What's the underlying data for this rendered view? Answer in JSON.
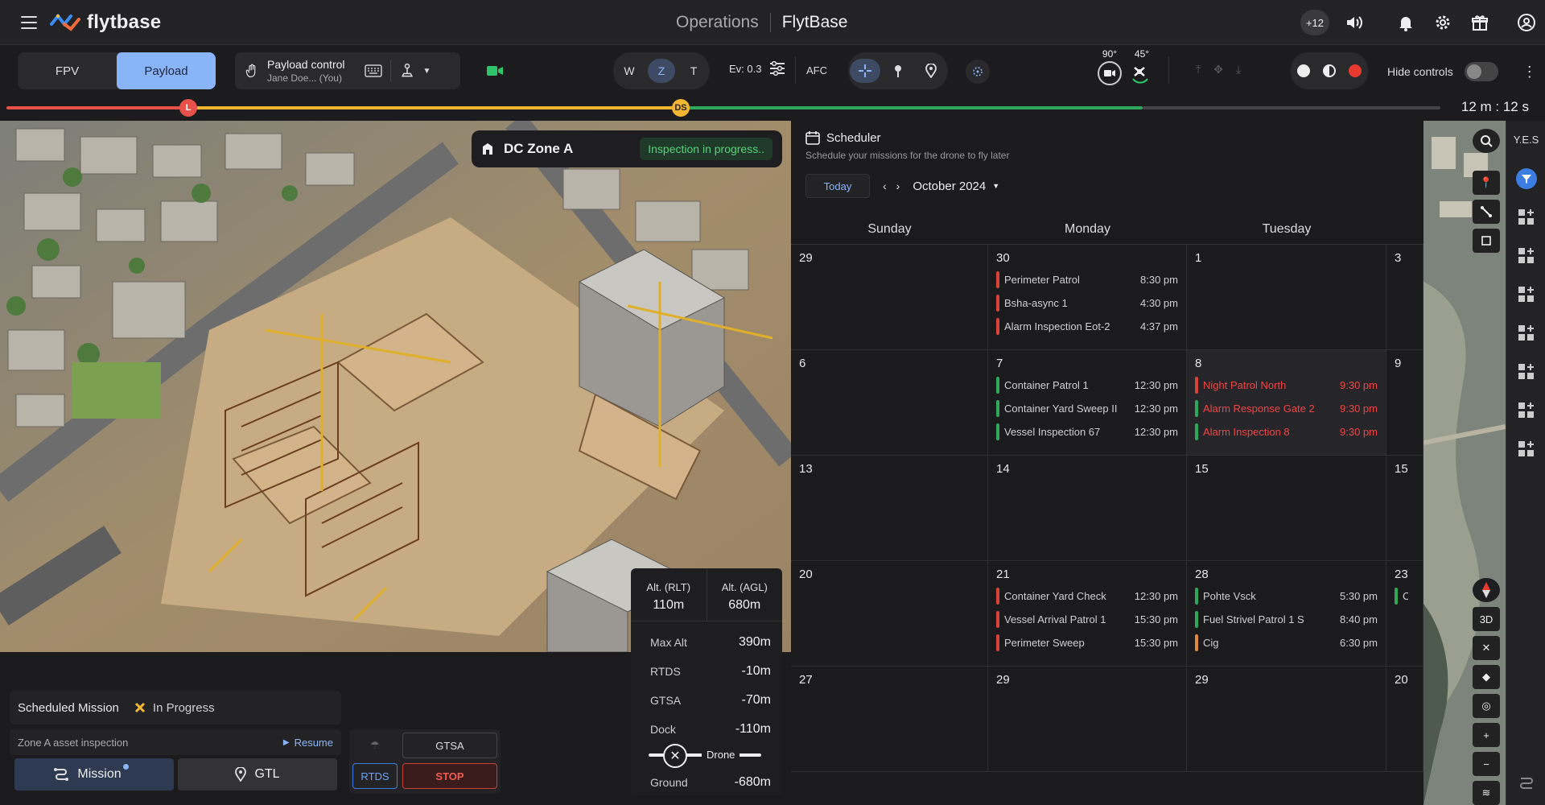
{
  "header": {
    "logo_text": "flytbase",
    "breadcrumb_left": "Operations",
    "breadcrumb_right": "FlytBase",
    "badge_count": "+12",
    "icons": [
      "volume-icon",
      "bell-icon",
      "gear-icon",
      "gift-icon",
      "account-icon"
    ]
  },
  "toolbar": {
    "view_options": [
      "FPV",
      "Payload"
    ],
    "view_selected": "Payload",
    "payload_title": "Payload control",
    "payload_user": "Jane Doe... (You)",
    "zoom_options": [
      "W",
      "Z",
      "T"
    ],
    "zoom_selected": "Z",
    "ev_label": "Ev: 0.3",
    "afc_label": "AFC",
    "gimbal_pitch": "90°",
    "gimbal_yaw": "45°",
    "hide_controls_label": "Hide controls",
    "hide_controls_on": false
  },
  "timeline": {
    "marker_l": "L",
    "marker_ds": "DS",
    "elapsed": "12 m : 12 s",
    "colors": {
      "red": "#e8514a",
      "yellow": "#f2b633",
      "green": "#2ea85a",
      "grey": "#555555"
    }
  },
  "zone_card": {
    "name": "DC Zone A",
    "status": "Inspection in progress.."
  },
  "altitude": {
    "rlt_label": "Alt. (RLT)",
    "rlt_value": "110m",
    "agl_label": "Alt. (AGL)",
    "agl_value": "680m",
    "rows": [
      {
        "label": "Max Alt",
        "value": "390m"
      },
      {
        "label": "RTDS",
        "value": "-10m"
      },
      {
        "label": "GTSA",
        "value": "-70m"
      },
      {
        "label": "Dock",
        "value": "-110m"
      }
    ],
    "drone_label": "Drone",
    "ground_label": "Ground",
    "ground_value": "-680m"
  },
  "mission": {
    "title": "Scheduled Mission",
    "status": "In Progress",
    "zone_text": "Zone A asset inspection",
    "resume_label": "Resume",
    "mission_btn": "Mission",
    "gtl_btn": "GTL",
    "gtsa_btn": "GTSA",
    "rtds_btn": "RTDS",
    "stop_btn": "STOP"
  },
  "scheduler": {
    "title": "Scheduler",
    "subtitle": "Schedule your missions for the drone to fly later",
    "today_label": "Today",
    "month_label": "October 2024",
    "days": [
      "Sunday",
      "Monday",
      "Tuesday"
    ],
    "rows": [
      [
        {
          "num": "29",
          "events": []
        },
        {
          "num": "30",
          "events": [
            {
              "name": "Perimeter Patrol",
              "time": "8:30 pm",
              "color": "#d9423c"
            },
            {
              "name": "Bsha-async 1",
              "time": "4:30 pm",
              "color": "#d9423c"
            },
            {
              "name": "Alarm Inspection Eot-2",
              "time": "4:37 pm",
              "color": "#d9423c"
            }
          ]
        },
        {
          "num": "1",
          "events": []
        },
        {
          "num": "3",
          "events": []
        }
      ],
      [
        {
          "num": "6",
          "events": []
        },
        {
          "num": "7",
          "events": [
            {
              "name": "Container Patrol 1",
              "time": "12:30 pm",
              "color": "#2ea85a"
            },
            {
              "name": "Container Yard Sweep II",
              "time": "12:30 pm",
              "color": "#2ea85a"
            },
            {
              "name": "Vessel Inspection 67",
              "time": "12:30 pm",
              "color": "#2ea85a"
            }
          ]
        },
        {
          "num": "8",
          "highlight": true,
          "events": [
            {
              "name": "Night Patrol North",
              "time": "9:30 pm",
              "color": "#d9423c",
              "alert": true
            },
            {
              "name": "Alarm Response Gate 2",
              "time": "9:30 pm",
              "color": "#2ea85a",
              "alert": true
            },
            {
              "name": "Alarm Inspection 8",
              "time": "9:30 pm",
              "color": "#2ea85a",
              "alert": true
            }
          ]
        },
        {
          "num": "9",
          "events": []
        }
      ],
      [
        {
          "num": "13",
          "events": []
        },
        {
          "num": "14",
          "events": []
        },
        {
          "num": "15",
          "events": []
        },
        {
          "num": "15",
          "events": []
        }
      ],
      [
        {
          "num": "20",
          "events": []
        },
        {
          "num": "21",
          "events": [
            {
              "name": "Container Yard Check",
              "time": "12:30 pm",
              "color": "#d9423c"
            },
            {
              "name": "Vessel Arrival Patrol 1",
              "time": "15:30 pm",
              "color": "#d9423c"
            },
            {
              "name": "Perimeter Sweep",
              "time": "15:30 pm",
              "color": "#d9423c"
            }
          ]
        },
        {
          "num": "28",
          "events": [
            {
              "name": "Pohte Vsck",
              "time": "5:30 pm",
              "color": "#2ea85a"
            },
            {
              "name": "Fuel Strivel Patrol 1 S",
              "time": "8:40 pm",
              "color": "#2ea85a"
            },
            {
              "name": "Cig",
              "time": "6:30 pm",
              "color": "#e0893a"
            }
          ]
        },
        {
          "num": "23",
          "events": [
            {
              "name": "Chec",
              "time": "",
              "color": "#2ea85a"
            }
          ]
        }
      ],
      [
        {
          "num": "27",
          "events": []
        },
        {
          "num": "29",
          "events": []
        },
        {
          "num": "29",
          "events": []
        },
        {
          "num": "20",
          "events": []
        }
      ]
    ]
  },
  "map": {
    "view_3d_label": "3D",
    "rail_label": "Y.E.S"
  }
}
